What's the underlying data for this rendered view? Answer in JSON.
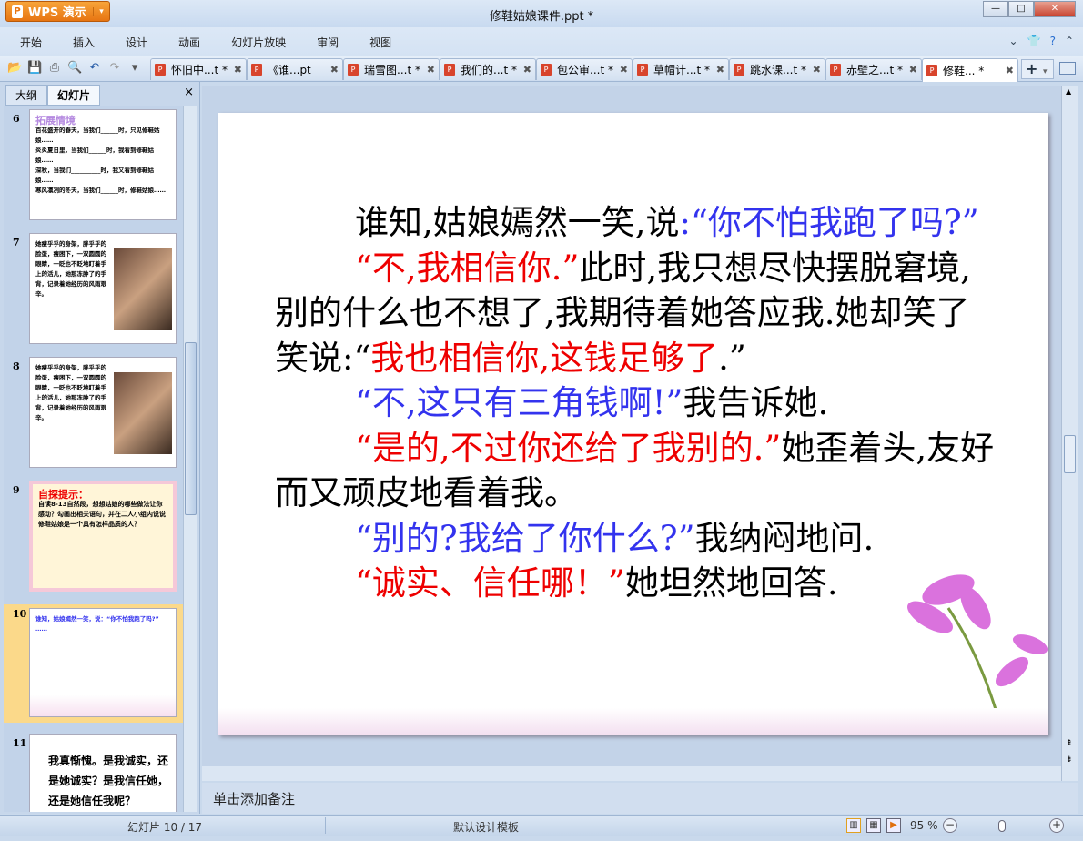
{
  "app": {
    "name": "WPS 演示",
    "doc_title": "修鞋姑娘课件.ppt *"
  },
  "menu": [
    "开始",
    "插入",
    "设计",
    "动画",
    "幻灯片放映",
    "审阅",
    "视图"
  ],
  "doc_tabs": [
    {
      "label": "怀旧中...t *"
    },
    {
      "label": "《谁...pt"
    },
    {
      "label": "瑞雪图...t *"
    },
    {
      "label": "我们的...t *"
    },
    {
      "label": "包公审...t *"
    },
    {
      "label": "草帽计...t *"
    },
    {
      "label": "跳水课...t *"
    },
    {
      "label": "赤壁之...t *"
    },
    {
      "label": "修鞋... *",
      "active": true
    }
  ],
  "panel": {
    "tab_outline": "大纲",
    "tab_slides": "幻灯片",
    "close": "×"
  },
  "thumbnails": [
    {
      "num": "6",
      "title": "拓展情境",
      "lines": [
        "百花盛开的春天，当我们______时，只见修鞋姑娘……",
        "炎炎夏日里，当我们______时，我看到修鞋姑娘……",
        "深秋，当我们__________时，我又看到修鞋姑娘……",
        "寒风凛冽的冬天，当我们______时，修鞋姑娘……"
      ]
    },
    {
      "num": "7",
      "text": "她瘦乎乎的身架，胖乎乎的脸蛋，瘦困下，一双圆圆的眼睛，一眨也不眨地盯着手上的活儿，她那冻肿了的手背，记录着她经历的风雨艰辛。"
    },
    {
      "num": "8",
      "text": "她瘦乎乎的身架，胖乎乎的脸蛋，瘦困下，一双圆圆的眼睛，一眨也不眨地盯着手上的活儿，她那冻肿了的手背，记录着她经历的风雨艰辛。"
    },
    {
      "num": "9",
      "title": "自探提示：",
      "text": "自读8-13自然段，想想姑娘的哪些做法让你感动？勾画出相关语句，并在二人小组内说说修鞋姑娘是一个具有怎样品质的人？"
    },
    {
      "num": "10",
      "text": "谁知，姑娘嫣然一笑，说：“你不怕我跑了吗?” ……"
    },
    {
      "num": "11",
      "text": "我真惭愧。是我诚实，还是她诚实？是我信任她，还是她信任我呢？"
    }
  ],
  "slide": {
    "paragraphs": [
      {
        "indent": true,
        "segments": [
          {
            "t": "谁知,姑娘嫣然一笑,说",
            "c": "#000000"
          },
          {
            "t": ":“你不怕我跑了吗?”",
            "c": "#3333ee"
          }
        ]
      },
      {
        "indent": true,
        "segments": [
          {
            "t": "“不,我相信你.”",
            "c": "#ee0000"
          },
          {
            "t": "此时,我只想尽快摆脱窘境,别的什么也不想了,我期待着她答应我.她却笑了笑说:“",
            "c": "#000000"
          },
          {
            "t": "我也相信你,这钱足够了",
            "c": "#ee0000"
          },
          {
            "t": ".”",
            "c": "#000000"
          }
        ]
      },
      {
        "indent": true,
        "segments": [
          {
            "t": "“不,这只有三角钱啊!”",
            "c": "#3333ee"
          },
          {
            "t": "我告诉她.",
            "c": "#000000"
          }
        ]
      },
      {
        "indent": true,
        "segments": [
          {
            "t": "“是的,不过你还给了我别的.”",
            "c": "#ee0000"
          },
          {
            "t": "她歪着头,友好而又顽皮地看着我。",
            "c": "#000000"
          }
        ]
      },
      {
        "indent": true,
        "segments": [
          {
            "t": "“别的?我给了你什么?”",
            "c": "#3333ee"
          },
          {
            "t": "我纳闷地问.",
            "c": "#000000"
          }
        ]
      },
      {
        "indent": true,
        "segments": [
          {
            "t": "“诚实、信任哪！”",
            "c": "#ee0000"
          },
          {
            "t": "她坦然地回答.",
            "c": "#000000"
          }
        ]
      }
    ]
  },
  "notes_placeholder": "单击添加备注",
  "status": {
    "slide_counter": "幻灯片 10 / 17",
    "template": "默认设计模板",
    "zoom": "95 %",
    "zoom_percent": 95
  }
}
